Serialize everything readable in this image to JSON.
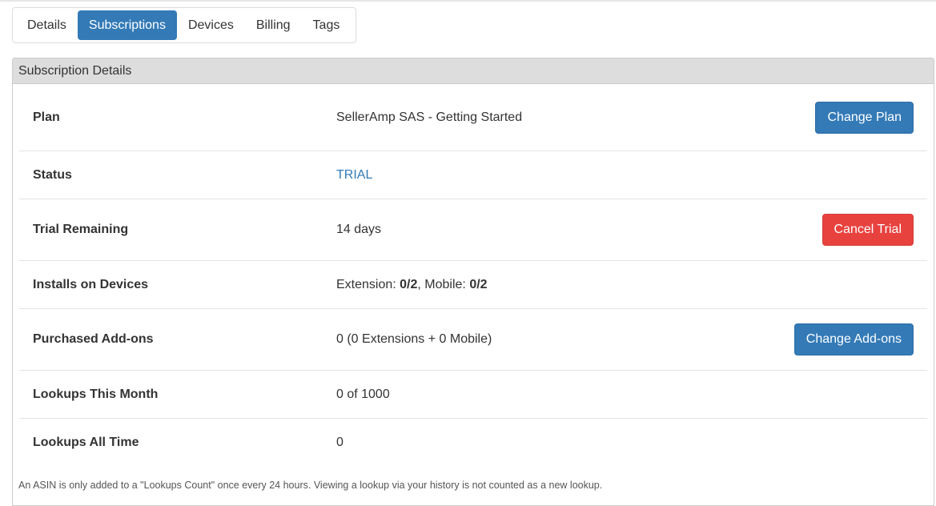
{
  "tabs": [
    {
      "label": "Details",
      "active": false
    },
    {
      "label": "Subscriptions",
      "active": true
    },
    {
      "label": "Devices",
      "active": false
    },
    {
      "label": "Billing",
      "active": false
    },
    {
      "label": "Tags",
      "active": false
    }
  ],
  "panel": {
    "title": "Subscription Details",
    "rows": {
      "plan": {
        "label": "Plan",
        "value": "SellerAmp SAS - Getting Started",
        "button": "Change Plan"
      },
      "status": {
        "label": "Status",
        "value": "TRIAL"
      },
      "trial": {
        "label": "Trial Remaining",
        "value": "14 days",
        "button": "Cancel Trial"
      },
      "installs": {
        "label": "Installs on Devices",
        "extension_prefix": "Extension: ",
        "extension_value": "0/2",
        "mobile_prefix": ", Mobile: ",
        "mobile_value": "0/2"
      },
      "addons": {
        "label": "Purchased Add-ons",
        "value": "0 (0 Extensions + 0 Mobile)",
        "button": "Change Add-ons"
      },
      "lookups_month": {
        "label": "Lookups This Month",
        "value": "0 of 1000"
      },
      "lookups_all": {
        "label": "Lookups All Time",
        "value": "0"
      }
    },
    "note": "An ASIN is only added to a \"Lookups Count\" once every 24 hours. Viewing a lookup via your history is not counted as a new lookup."
  },
  "colors": {
    "primary": "#337ab7",
    "danger": "#e8423f",
    "heading_bg": "#dddddd"
  }
}
